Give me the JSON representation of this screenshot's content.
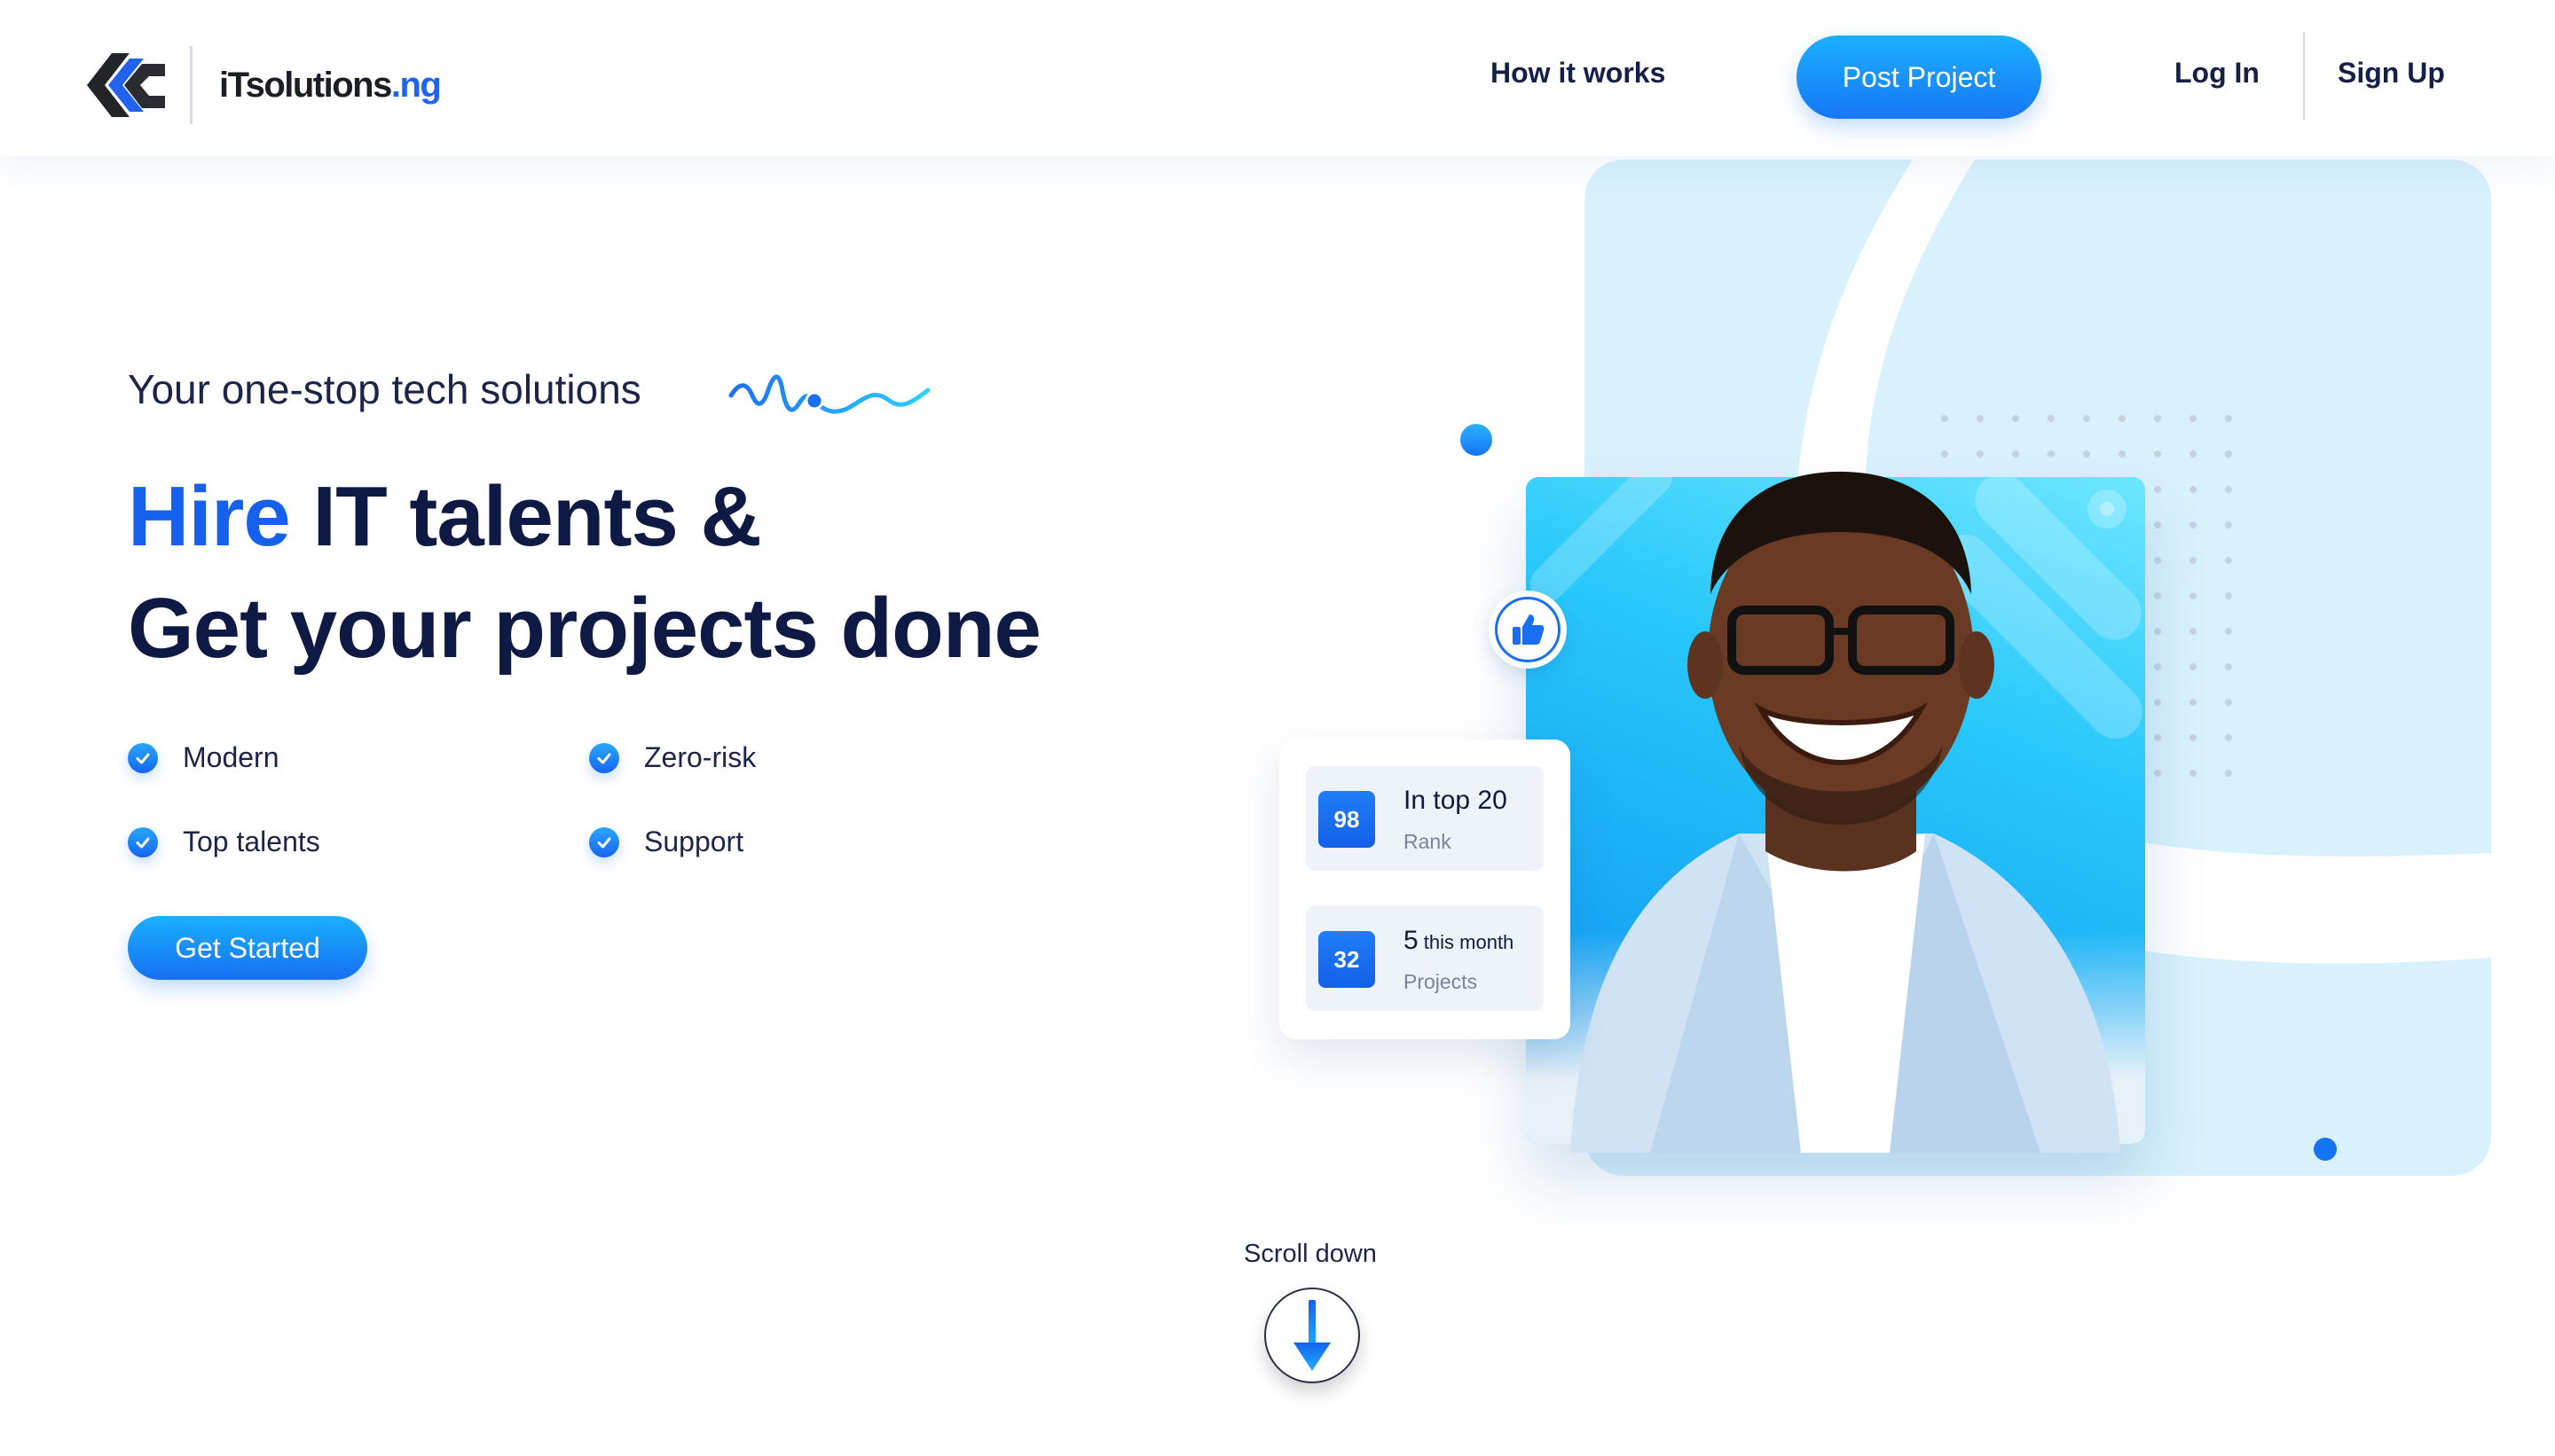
{
  "header": {
    "logo_text": "iTsolutions",
    "logo_tld": ".ng",
    "nav": {
      "how_it_works": "How it works",
      "post_project": "Post Project",
      "log_in": "Log In",
      "sign_up": "Sign Up"
    }
  },
  "hero": {
    "tagline": "Your one-stop tech solutions",
    "headline": {
      "accent": "Hire",
      "line1_rest": " IT talents &",
      "line2": "Get your projects done"
    },
    "features": [
      "Modern",
      "Zero-risk",
      "Top talents",
      "Support"
    ],
    "cta_label": "Get Started"
  },
  "stats_card": {
    "items": [
      {
        "badge": "98",
        "title_main": "In top 20",
        "title_small": "",
        "subtitle": "Rank"
      },
      {
        "badge": "32",
        "title_main": "5",
        "title_small": " this month",
        "subtitle": "Projects"
      }
    ]
  },
  "scroll": {
    "label": "Scroll down"
  },
  "colors": {
    "brand_blue": "#1561ee",
    "navy_text": "#0e1a44",
    "button_gradient_top": "#1bb0ff",
    "button_gradient_bottom": "#1877f6",
    "panel_bg": "#d8f1fd"
  },
  "icons": {
    "logo": "itsolutions-logo-icon",
    "feature_check": "check-circle-icon",
    "like": "thumbs-up-icon",
    "scroll": "arrow-down-icon",
    "squiggle": "wave-squiggle-icon"
  }
}
